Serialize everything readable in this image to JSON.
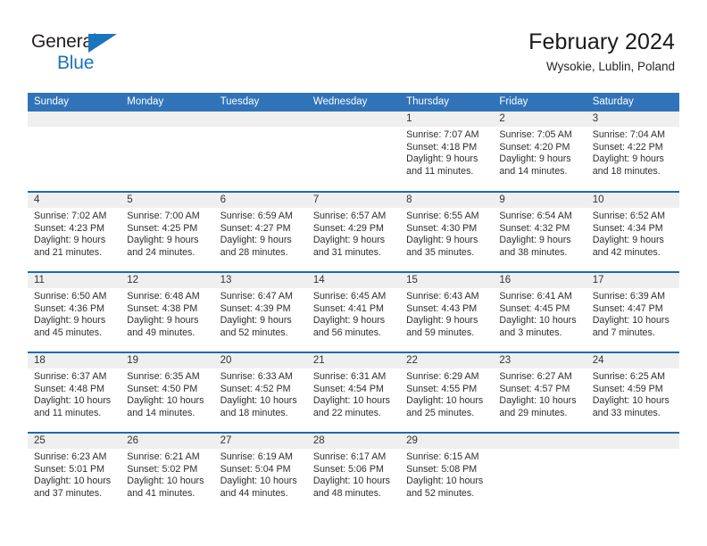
{
  "brand": {
    "name_part1": "General",
    "name_part2": "Blue",
    "flag_icon": "triangle-flag-icon"
  },
  "header": {
    "title": "February 2024",
    "location": "Wysokie, Lublin, Poland"
  },
  "calendar": {
    "weekday_headers": [
      "Sunday",
      "Monday",
      "Tuesday",
      "Wednesday",
      "Thursday",
      "Friday",
      "Saturday"
    ],
    "weeks": [
      [
        {
          "day": "",
          "lines": ""
        },
        {
          "day": "",
          "lines": ""
        },
        {
          "day": "",
          "lines": ""
        },
        {
          "day": "",
          "lines": ""
        },
        {
          "day": "1",
          "lines": "Sunrise: 7:07 AM\nSunset: 4:18 PM\nDaylight: 9 hours\nand 11 minutes."
        },
        {
          "day": "2",
          "lines": "Sunrise: 7:05 AM\nSunset: 4:20 PM\nDaylight: 9 hours\nand 14 minutes."
        },
        {
          "day": "3",
          "lines": "Sunrise: 7:04 AM\nSunset: 4:22 PM\nDaylight: 9 hours\nand 18 minutes."
        }
      ],
      [
        {
          "day": "4",
          "lines": "Sunrise: 7:02 AM\nSunset: 4:23 PM\nDaylight: 9 hours\nand 21 minutes."
        },
        {
          "day": "5",
          "lines": "Sunrise: 7:00 AM\nSunset: 4:25 PM\nDaylight: 9 hours\nand 24 minutes."
        },
        {
          "day": "6",
          "lines": "Sunrise: 6:59 AM\nSunset: 4:27 PM\nDaylight: 9 hours\nand 28 minutes."
        },
        {
          "day": "7",
          "lines": "Sunrise: 6:57 AM\nSunset: 4:29 PM\nDaylight: 9 hours\nand 31 minutes."
        },
        {
          "day": "8",
          "lines": "Sunrise: 6:55 AM\nSunset: 4:30 PM\nDaylight: 9 hours\nand 35 minutes."
        },
        {
          "day": "9",
          "lines": "Sunrise: 6:54 AM\nSunset: 4:32 PM\nDaylight: 9 hours\nand 38 minutes."
        },
        {
          "day": "10",
          "lines": "Sunrise: 6:52 AM\nSunset: 4:34 PM\nDaylight: 9 hours\nand 42 minutes."
        }
      ],
      [
        {
          "day": "11",
          "lines": "Sunrise: 6:50 AM\nSunset: 4:36 PM\nDaylight: 9 hours\nand 45 minutes."
        },
        {
          "day": "12",
          "lines": "Sunrise: 6:48 AM\nSunset: 4:38 PM\nDaylight: 9 hours\nand 49 minutes."
        },
        {
          "day": "13",
          "lines": "Sunrise: 6:47 AM\nSunset: 4:39 PM\nDaylight: 9 hours\nand 52 minutes."
        },
        {
          "day": "14",
          "lines": "Sunrise: 6:45 AM\nSunset: 4:41 PM\nDaylight: 9 hours\nand 56 minutes."
        },
        {
          "day": "15",
          "lines": "Sunrise: 6:43 AM\nSunset: 4:43 PM\nDaylight: 9 hours\nand 59 minutes."
        },
        {
          "day": "16",
          "lines": "Sunrise: 6:41 AM\nSunset: 4:45 PM\nDaylight: 10 hours\nand 3 minutes."
        },
        {
          "day": "17",
          "lines": "Sunrise: 6:39 AM\nSunset: 4:47 PM\nDaylight: 10 hours\nand 7 minutes."
        }
      ],
      [
        {
          "day": "18",
          "lines": "Sunrise: 6:37 AM\nSunset: 4:48 PM\nDaylight: 10 hours\nand 11 minutes."
        },
        {
          "day": "19",
          "lines": "Sunrise: 6:35 AM\nSunset: 4:50 PM\nDaylight: 10 hours\nand 14 minutes."
        },
        {
          "day": "20",
          "lines": "Sunrise: 6:33 AM\nSunset: 4:52 PM\nDaylight: 10 hours\nand 18 minutes."
        },
        {
          "day": "21",
          "lines": "Sunrise: 6:31 AM\nSunset: 4:54 PM\nDaylight: 10 hours\nand 22 minutes."
        },
        {
          "day": "22",
          "lines": "Sunrise: 6:29 AM\nSunset: 4:55 PM\nDaylight: 10 hours\nand 25 minutes."
        },
        {
          "day": "23",
          "lines": "Sunrise: 6:27 AM\nSunset: 4:57 PM\nDaylight: 10 hours\nand 29 minutes."
        },
        {
          "day": "24",
          "lines": "Sunrise: 6:25 AM\nSunset: 4:59 PM\nDaylight: 10 hours\nand 33 minutes."
        }
      ],
      [
        {
          "day": "25",
          "lines": "Sunrise: 6:23 AM\nSunset: 5:01 PM\nDaylight: 10 hours\nand 37 minutes."
        },
        {
          "day": "26",
          "lines": "Sunrise: 6:21 AM\nSunset: 5:02 PM\nDaylight: 10 hours\nand 41 minutes."
        },
        {
          "day": "27",
          "lines": "Sunrise: 6:19 AM\nSunset: 5:04 PM\nDaylight: 10 hours\nand 44 minutes."
        },
        {
          "day": "28",
          "lines": "Sunrise: 6:17 AM\nSunset: 5:06 PM\nDaylight: 10 hours\nand 48 minutes."
        },
        {
          "day": "29",
          "lines": "Sunrise: 6:15 AM\nSunset: 5:08 PM\nDaylight: 10 hours\nand 52 minutes."
        },
        {
          "day": "",
          "lines": ""
        },
        {
          "day": "",
          "lines": ""
        }
      ]
    ]
  },
  "colors": {
    "header_blue": "#3173b8",
    "row_border_blue": "#1f6aab",
    "daynum_band_gray": "#efefef",
    "brand_blue": "#1b74bc"
  }
}
